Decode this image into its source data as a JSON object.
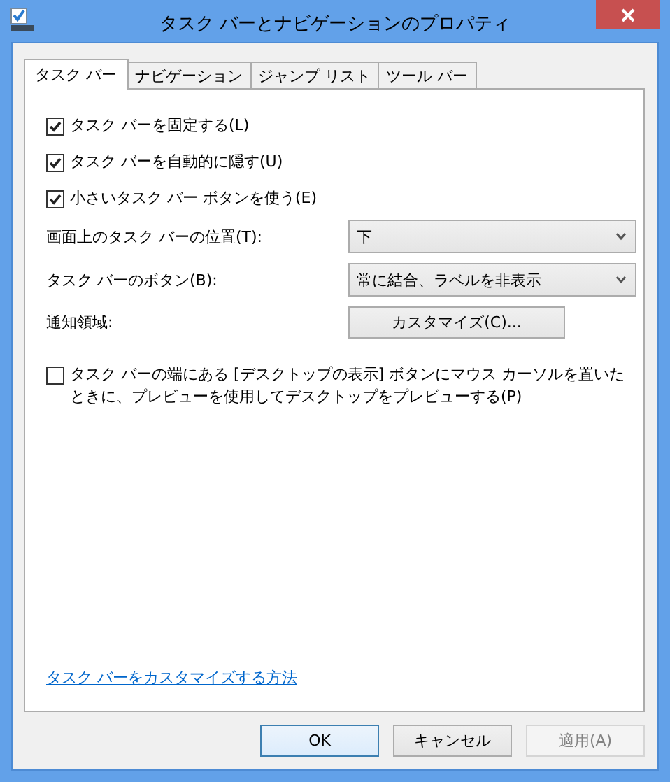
{
  "window": {
    "title": "タスク バーとナビゲーションのプロパティ"
  },
  "tabs": [
    {
      "label": "タスク バー",
      "selected": true
    },
    {
      "label": "ナビゲーション",
      "selected": false
    },
    {
      "label": "ジャンプ リスト",
      "selected": false
    },
    {
      "label": "ツール バー",
      "selected": false
    }
  ],
  "settings": [
    {
      "kind": "checkbox",
      "label": "タスク バーを固定する(L)",
      "checked": true
    },
    {
      "kind": "checkbox",
      "label": "タスク バーを自動的に隠す(U)",
      "checked": true
    },
    {
      "kind": "checkbox",
      "label": "小さいタスク バー ボタンを使う(E)",
      "checked": true
    },
    {
      "kind": "select",
      "label": "画面上のタスク バーの位置(T):",
      "value": "下"
    },
    {
      "kind": "select",
      "label": "タスク バーのボタン(B):",
      "value": "常に結合、ラベルを非表示"
    },
    {
      "kind": "button",
      "label": "通知領域:",
      "value": "カスタマイズ(C)..."
    }
  ],
  "preview_option": {
    "label": "タスク バーの端にある [デスクトップの表示] ボタンにマウス カーソルを置いたときに、プレビューを使用してデスクトップをプレビューする(P)",
    "checked": false
  },
  "help_link": "タスク バーをカスタマイズする方法",
  "buttons": [
    {
      "label": "OK",
      "disabled": false
    },
    {
      "label": "キャンセル",
      "disabled": false
    },
    {
      "label": "適用(A)",
      "disabled": true
    }
  ]
}
